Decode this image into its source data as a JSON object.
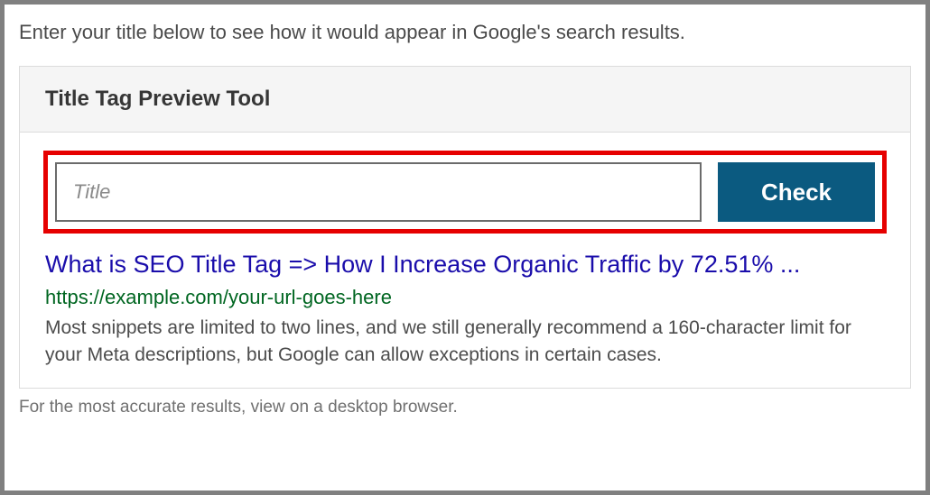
{
  "intro": "Enter your title below to see how it would appear in Google's search results.",
  "tool": {
    "header_title": "Title Tag Preview Tool",
    "input_placeholder": "Title",
    "input_value": "",
    "check_label": "Check"
  },
  "serp": {
    "title": "What is SEO Title Tag => How I Increase Organic Traffic by 72.51% ...",
    "url": "https://example.com/your-url-goes-here",
    "description": "Most snippets are limited to two lines, and we still generally recommend a 160-character limit for your Meta descriptions, but Google can allow exceptions in certain cases."
  },
  "footnote": "For the most accurate results, view on a desktop browser."
}
